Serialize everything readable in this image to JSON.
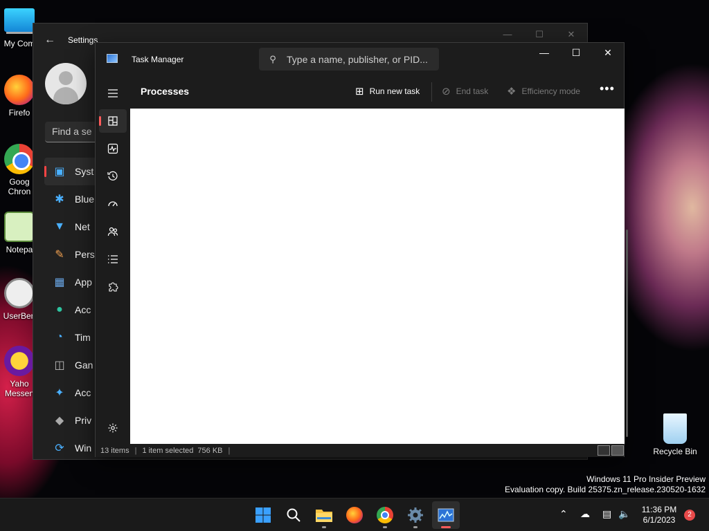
{
  "desktop": {
    "icons": [
      {
        "label": "My Com"
      },
      {
        "label": "Firefo"
      },
      {
        "label": "Goog Chron"
      },
      {
        "label": "Notepa"
      },
      {
        "label": "UserBen"
      },
      {
        "label": "Yaho Messen"
      },
      {
        "label": "Recycle Bin"
      }
    ]
  },
  "settings": {
    "title": "Settings",
    "search_placeholder": "Find a se",
    "nav": [
      {
        "label": "Syst",
        "icon": "monitor-icon"
      },
      {
        "label": "Blue",
        "icon": "bluetooth-icon"
      },
      {
        "label": "Net",
        "icon": "wifi-icon"
      },
      {
        "label": "Pers",
        "icon": "brush-icon"
      },
      {
        "label": "App",
        "icon": "apps-icon"
      },
      {
        "label": "Acc",
        "icon": "person-icon"
      },
      {
        "label": "Tim",
        "icon": "globe-clock-icon"
      },
      {
        "label": "Gan",
        "icon": "gamepad-icon"
      },
      {
        "label": "Acc",
        "icon": "accessibility-icon"
      },
      {
        "label": "Priv",
        "icon": "shield-icon"
      },
      {
        "label": "Win",
        "icon": "update-icon"
      }
    ]
  },
  "taskmanager": {
    "title": "Task Manager",
    "search_placeholder": "Type a name, publisher, or PID...",
    "page_title": "Processes",
    "commands": {
      "run_new_task": "Run new task",
      "end_task": "End task",
      "efficiency_mode": "Efficiency mode"
    },
    "status": {
      "items": "13 items",
      "selected": "1 item selected",
      "size": "756 KB"
    },
    "accent": "#ff5b5b"
  },
  "watermark": {
    "line1": "Windows 11 Pro Insider Preview",
    "line2": "Evaluation copy. Build 25375.zn_release.230520-1632"
  },
  "clock": {
    "time": "11:36 PM",
    "date": "6/1/2023"
  },
  "notifications": {
    "count": "2"
  }
}
